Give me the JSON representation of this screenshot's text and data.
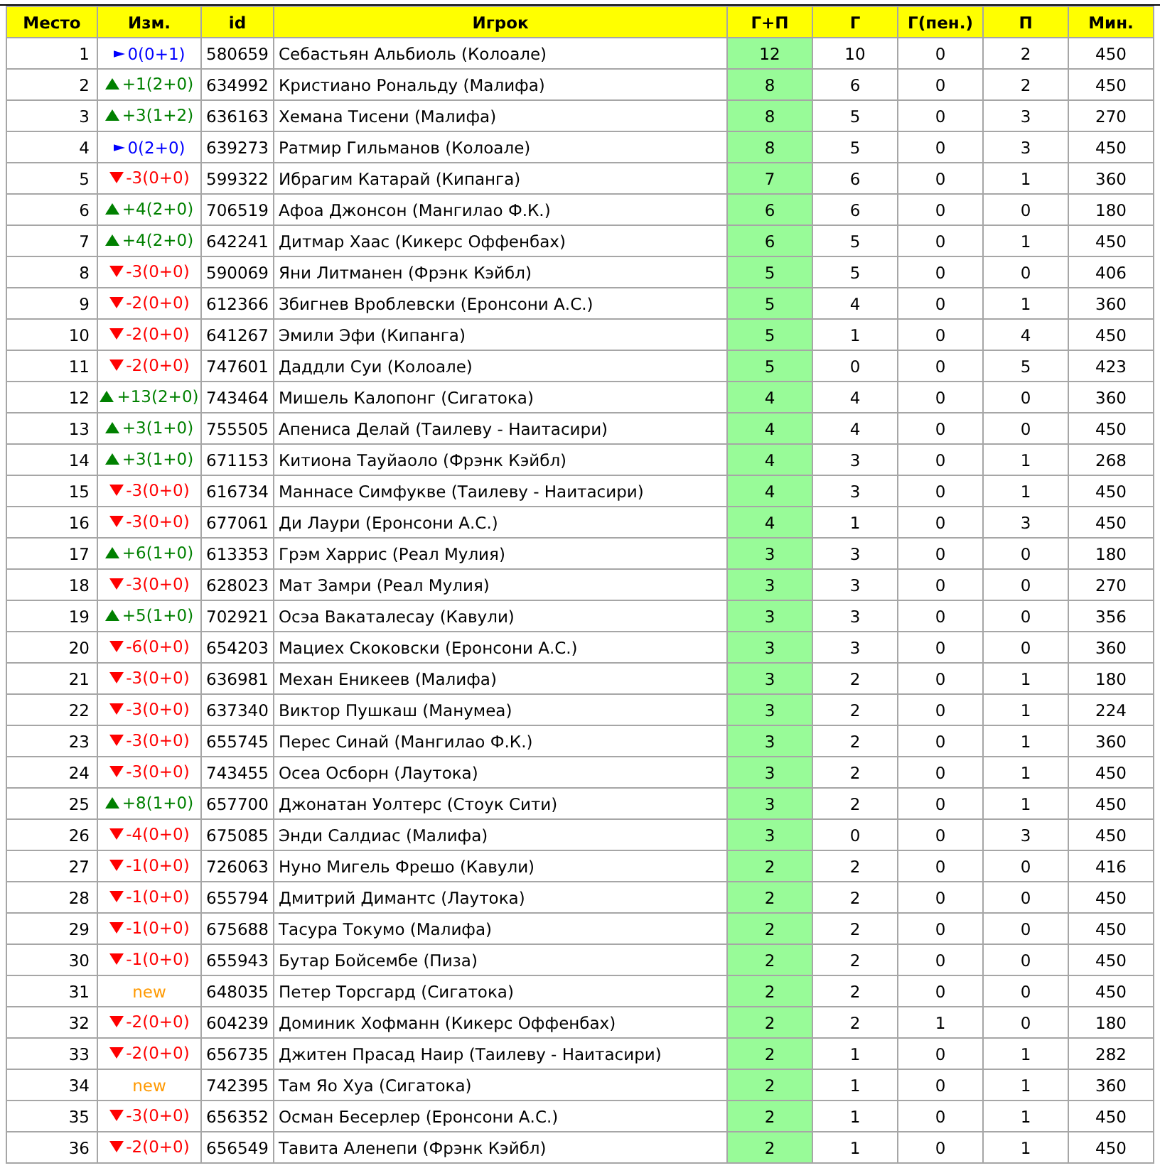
{
  "table": {
    "columns": [
      "Место",
      "Изм.",
      "id",
      "Игрок",
      "Г+П",
      "Г",
      "Г(пен.)",
      "П",
      "Мин."
    ],
    "rows": [
      {
        "place": "1",
        "change": {
          "kind": "same",
          "text": "0(0+1)"
        },
        "id": "580659",
        "player": "Себастьян Альбиоль (Колоале)",
        "gp": "12",
        "goals": "10",
        "pen_goals": "0",
        "assists": "2",
        "minutes": "450"
      },
      {
        "place": "2",
        "change": {
          "kind": "up",
          "text": "+1(2+0)"
        },
        "id": "634992",
        "player": "Кристиано Рональду (Малифа)",
        "gp": "8",
        "goals": "6",
        "pen_goals": "0",
        "assists": "2",
        "minutes": "450"
      },
      {
        "place": "3",
        "change": {
          "kind": "up",
          "text": "+3(1+2)"
        },
        "id": "636163",
        "player": "Хемана Тисени (Малифа)",
        "gp": "8",
        "goals": "5",
        "pen_goals": "0",
        "assists": "3",
        "minutes": "270"
      },
      {
        "place": "4",
        "change": {
          "kind": "same",
          "text": "0(2+0)"
        },
        "id": "639273",
        "player": "Ратмир Гильманов (Колоале)",
        "gp": "8",
        "goals": "5",
        "pen_goals": "0",
        "assists": "3",
        "minutes": "450"
      },
      {
        "place": "5",
        "change": {
          "kind": "down",
          "text": "-3(0+0)"
        },
        "id": "599322",
        "player": "Ибрагим Катарай (Кипанга)",
        "gp": "7",
        "goals": "6",
        "pen_goals": "0",
        "assists": "1",
        "minutes": "360"
      },
      {
        "place": "6",
        "change": {
          "kind": "up",
          "text": "+4(2+0)"
        },
        "id": "706519",
        "player": "Афоа Джонсон (Мангилао Ф.К.)",
        "gp": "6",
        "goals": "6",
        "pen_goals": "0",
        "assists": "0",
        "minutes": "180"
      },
      {
        "place": "7",
        "change": {
          "kind": "up",
          "text": "+4(2+0)"
        },
        "id": "642241",
        "player": "Дитмар Хаас (Кикерс Оффенбах)",
        "gp": "6",
        "goals": "5",
        "pen_goals": "0",
        "assists": "1",
        "minutes": "450"
      },
      {
        "place": "8",
        "change": {
          "kind": "down",
          "text": "-3(0+0)"
        },
        "id": "590069",
        "player": "Яни Литманен (Фрэнк Кэйбл)",
        "gp": "5",
        "goals": "5",
        "pen_goals": "0",
        "assists": "0",
        "minutes": "406"
      },
      {
        "place": "9",
        "change": {
          "kind": "down",
          "text": "-2(0+0)"
        },
        "id": "612366",
        "player": "Збигнев Вроблевски (Еронсони А.С.)",
        "gp": "5",
        "goals": "4",
        "pen_goals": "0",
        "assists": "1",
        "minutes": "360"
      },
      {
        "place": "10",
        "change": {
          "kind": "down",
          "text": "-2(0+0)"
        },
        "id": "641267",
        "player": "Эмили Эфи (Кипанга)",
        "gp": "5",
        "goals": "1",
        "pen_goals": "0",
        "assists": "4",
        "minutes": "450"
      },
      {
        "place": "11",
        "change": {
          "kind": "down",
          "text": "-2(0+0)"
        },
        "id": "747601",
        "player": "Даддли Суи (Колоале)",
        "gp": "5",
        "goals": "0",
        "pen_goals": "0",
        "assists": "5",
        "minutes": "423"
      },
      {
        "place": "12",
        "change": {
          "kind": "up",
          "text": "+13(2+0)"
        },
        "id": "743464",
        "player": "Мишель Калопонг (Сигатока)",
        "gp": "4",
        "goals": "4",
        "pen_goals": "0",
        "assists": "0",
        "minutes": "360"
      },
      {
        "place": "13",
        "change": {
          "kind": "up",
          "text": "+3(1+0)"
        },
        "id": "755505",
        "player": "Апениса Делай (Таилеву - Наитасири)",
        "gp": "4",
        "goals": "4",
        "pen_goals": "0",
        "assists": "0",
        "minutes": "450"
      },
      {
        "place": "14",
        "change": {
          "kind": "up",
          "text": "+3(1+0)"
        },
        "id": "671153",
        "player": "Китиона Тауйаоло (Фрэнк Кэйбл)",
        "gp": "4",
        "goals": "3",
        "pen_goals": "0",
        "assists": "1",
        "minutes": "268"
      },
      {
        "place": "15",
        "change": {
          "kind": "down",
          "text": "-3(0+0)"
        },
        "id": "616734",
        "player": "Маннасе Симфукве (Таилеву - Наитасири)",
        "gp": "4",
        "goals": "3",
        "pen_goals": "0",
        "assists": "1",
        "minutes": "450"
      },
      {
        "place": "16",
        "change": {
          "kind": "down",
          "text": "-3(0+0)"
        },
        "id": "677061",
        "player": "Ди Лаури (Еронсони А.С.)",
        "gp": "4",
        "goals": "1",
        "pen_goals": "0",
        "assists": "3",
        "minutes": "450"
      },
      {
        "place": "17",
        "change": {
          "kind": "up",
          "text": "+6(1+0)"
        },
        "id": "613353",
        "player": "Грэм Харрис (Реал Мулия)",
        "gp": "3",
        "goals": "3",
        "pen_goals": "0",
        "assists": "0",
        "minutes": "180"
      },
      {
        "place": "18",
        "change": {
          "kind": "down",
          "text": "-3(0+0)"
        },
        "id": "628023",
        "player": "Мат Замри (Реал Мулия)",
        "gp": "3",
        "goals": "3",
        "pen_goals": "0",
        "assists": "0",
        "minutes": "270"
      },
      {
        "place": "19",
        "change": {
          "kind": "up",
          "text": "+5(1+0)"
        },
        "id": "702921",
        "player": "Осэа Вакаталесау (Кавули)",
        "gp": "3",
        "goals": "3",
        "pen_goals": "0",
        "assists": "0",
        "minutes": "356"
      },
      {
        "place": "20",
        "change": {
          "kind": "down",
          "text": "-6(0+0)"
        },
        "id": "654203",
        "player": "Мациех Скоковски (Еронсони А.С.)",
        "gp": "3",
        "goals": "3",
        "pen_goals": "0",
        "assists": "0",
        "minutes": "360"
      },
      {
        "place": "21",
        "change": {
          "kind": "down",
          "text": "-3(0+0)"
        },
        "id": "636981",
        "player": "Механ Еникеев (Малифа)",
        "gp": "3",
        "goals": "2",
        "pen_goals": "0",
        "assists": "1",
        "minutes": "180"
      },
      {
        "place": "22",
        "change": {
          "kind": "down",
          "text": "-3(0+0)"
        },
        "id": "637340",
        "player": "Виктор Пушкаш (Манумеа)",
        "gp": "3",
        "goals": "2",
        "pen_goals": "0",
        "assists": "1",
        "minutes": "224"
      },
      {
        "place": "23",
        "change": {
          "kind": "down",
          "text": "-3(0+0)"
        },
        "id": "655745",
        "player": "Перес Синай (Мангилао Ф.К.)",
        "gp": "3",
        "goals": "2",
        "pen_goals": "0",
        "assists": "1",
        "minutes": "360"
      },
      {
        "place": "24",
        "change": {
          "kind": "down",
          "text": "-3(0+0)"
        },
        "id": "743455",
        "player": "Осеа Осборн (Лаутока)",
        "gp": "3",
        "goals": "2",
        "pen_goals": "0",
        "assists": "1",
        "minutes": "450"
      },
      {
        "place": "25",
        "change": {
          "kind": "up",
          "text": "+8(1+0)"
        },
        "id": "657700",
        "player": "Джонатан Уолтерс (Стоук Сити)",
        "gp": "3",
        "goals": "2",
        "pen_goals": "0",
        "assists": "1",
        "minutes": "450"
      },
      {
        "place": "26",
        "change": {
          "kind": "down",
          "text": "-4(0+0)"
        },
        "id": "675085",
        "player": "Энди Салдиас (Малифа)",
        "gp": "3",
        "goals": "0",
        "pen_goals": "0",
        "assists": "3",
        "minutes": "450"
      },
      {
        "place": "27",
        "change": {
          "kind": "down",
          "text": "-1(0+0)"
        },
        "id": "726063",
        "player": "Нуно Мигель Фрешо (Кавули)",
        "gp": "2",
        "goals": "2",
        "pen_goals": "0",
        "assists": "0",
        "minutes": "416"
      },
      {
        "place": "28",
        "change": {
          "kind": "down",
          "text": "-1(0+0)"
        },
        "id": "655794",
        "player": "Дмитрий Димантс (Лаутока)",
        "gp": "2",
        "goals": "2",
        "pen_goals": "0",
        "assists": "0",
        "minutes": "450"
      },
      {
        "place": "29",
        "change": {
          "kind": "down",
          "text": "-1(0+0)"
        },
        "id": "675688",
        "player": "Тасура Токумо (Малифа)",
        "gp": "2",
        "goals": "2",
        "pen_goals": "0",
        "assists": "0",
        "minutes": "450"
      },
      {
        "place": "30",
        "change": {
          "kind": "down",
          "text": "-1(0+0)"
        },
        "id": "655943",
        "player": "Бутар Бойсембе (Пиза)",
        "gp": "2",
        "goals": "2",
        "pen_goals": "0",
        "assists": "0",
        "minutes": "450"
      },
      {
        "place": "31",
        "change": {
          "kind": "new",
          "text": "new"
        },
        "id": "648035",
        "player": "Петер Торсгард (Сигатока)",
        "gp": "2",
        "goals": "2",
        "pen_goals": "0",
        "assists": "0",
        "minutes": "450"
      },
      {
        "place": "32",
        "change": {
          "kind": "down",
          "text": "-2(0+0)"
        },
        "id": "604239",
        "player": "Доминик Хофманн (Кикерс Оффенбах)",
        "gp": "2",
        "goals": "2",
        "pen_goals": "1",
        "assists": "0",
        "minutes": "180"
      },
      {
        "place": "33",
        "change": {
          "kind": "down",
          "text": "-2(0+0)"
        },
        "id": "656735",
        "player": "Джитен Прасад Наир (Таилеву - Наитасири)",
        "gp": "2",
        "goals": "1",
        "pen_goals": "0",
        "assists": "1",
        "minutes": "282"
      },
      {
        "place": "34",
        "change": {
          "kind": "new",
          "text": "new"
        },
        "id": "742395",
        "player": "Там Яо Хуа (Сигатока)",
        "gp": "2",
        "goals": "1",
        "pen_goals": "0",
        "assists": "1",
        "minutes": "360"
      },
      {
        "place": "35",
        "change": {
          "kind": "down",
          "text": "-3(0+0)"
        },
        "id": "656352",
        "player": "Осман Бесерлер (Еронсони А.С.)",
        "gp": "2",
        "goals": "1",
        "pen_goals": "0",
        "assists": "1",
        "minutes": "450"
      },
      {
        "place": "36",
        "change": {
          "kind": "down",
          "text": "-2(0+0)"
        },
        "id": "656549",
        "player": "Тавита Аленепи (Фрэнк Кэйбл)",
        "gp": "2",
        "goals": "1",
        "pen_goals": "0",
        "assists": "1",
        "minutes": "450"
      }
    ]
  }
}
